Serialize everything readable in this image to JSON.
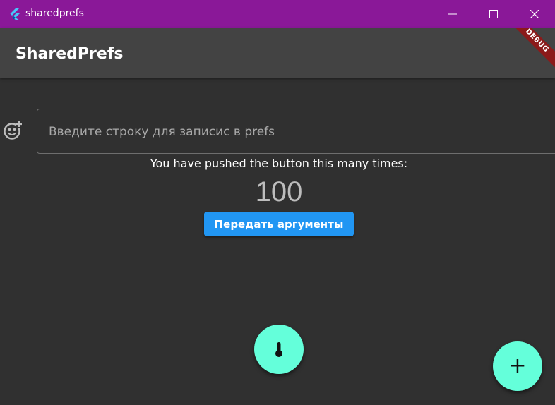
{
  "window": {
    "title": "sharedprefs",
    "minimize_icon": "minimize-icon",
    "maximize_icon": "maximize-icon",
    "close_icon": "close-icon",
    "titlebar_color": "#8a1898"
  },
  "appbar": {
    "title": "SharedPrefs",
    "debug_banner": "DEBUG",
    "background": "#434343"
  },
  "form": {
    "prefix_icon": "emoji-add-icon",
    "placeholder": "Введите строку для записис в prefs",
    "value": ""
  },
  "counter": {
    "label": "You have pushed the button this many times:",
    "value": "100"
  },
  "args_button": {
    "label": "Передать аргументы",
    "color": "#2196f3"
  },
  "fabs": {
    "thermometer_icon": "thermometer-icon",
    "add_label": "+",
    "color": "#64ffda"
  }
}
